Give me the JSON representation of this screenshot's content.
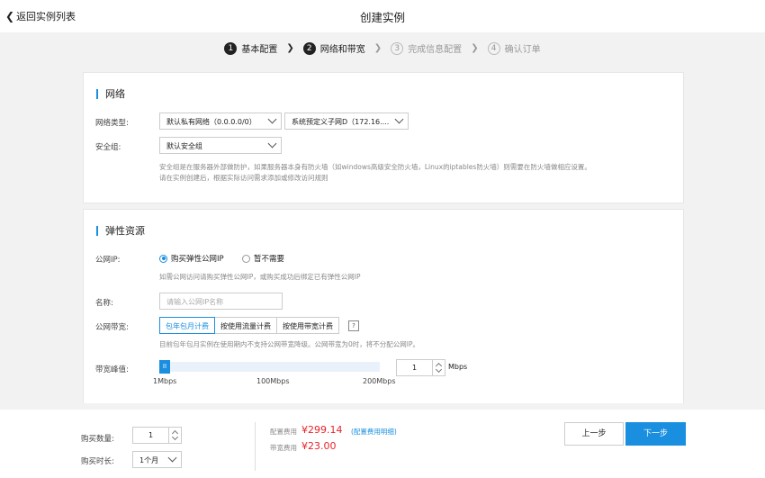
{
  "header": {
    "back_label": "返回实例列表",
    "title": "创建实例"
  },
  "steps": [
    {
      "num": "1",
      "label": "基本配置",
      "state": "done"
    },
    {
      "num": "2",
      "label": "网络和带宽",
      "state": "current"
    },
    {
      "num": "3",
      "label": "完成信息配置",
      "state": "todo"
    },
    {
      "num": "4",
      "label": "确认订单",
      "state": "todo"
    }
  ],
  "network": {
    "section_title": "网络",
    "type_label": "网络类型:",
    "vpc_value": "默认私有网络（0.0.0.0/0）",
    "subnet_value": "系统预定义子网D（172.16....",
    "sg_label": "安全组:",
    "sg_value": "默认安全组",
    "sg_hint_1": "安全组是在服务器外部做防护，如果服务器本身有防火墙（如windows高级安全防火墙，Linux的iptables防火墙）则需要在防火墙做相应设置。",
    "sg_hint_2": "请在实例创建后，根据实际访问需求添加或修改访问规则"
  },
  "eip": {
    "section_title": "弹性资源",
    "public_ip_label": "公网IP:",
    "option_buy": "购买弹性公网IP",
    "option_none": "暂不需要",
    "public_ip_hint": "如需公网访问请购买弹性公网IP，或购买成功后绑定已有弹性公网IP",
    "name_label": "名称:",
    "name_placeholder": "请输入公网IP名称",
    "bandwidth_label": "公网带宽:",
    "billing_options": [
      "包年包月计费",
      "按使用流量计费",
      "按使用带宽计费"
    ],
    "billing_selected": 0,
    "help_mark": "?",
    "bandwidth_hint": "目前包年包月实例在使用期内不支持公网带宽降级。公网带宽为0时，将不分配公网IP。",
    "peak_label": "带宽峰值:",
    "slider_handle": "II",
    "slider_ticks": [
      "1Mbps",
      "100Mbps",
      "200Mbps"
    ],
    "peak_value": "1",
    "peak_unit": "Mbps",
    "slider_fraction": 0.0
  },
  "footer": {
    "qty_label": "购买数量:",
    "qty_value": "1",
    "duration_label": "购买时长:",
    "duration_value": "1个月",
    "config_fee_label": "配置费用",
    "config_fee_value": "¥299.14",
    "config_detail_link": "(配置费用明细)",
    "bandwidth_fee_label": "带宽费用",
    "bandwidth_fee_value": "¥23.00",
    "prev_label": "上一步",
    "next_label": "下一步"
  },
  "colors": {
    "accent": "#1a8fdf",
    "price": "#e8232b"
  }
}
